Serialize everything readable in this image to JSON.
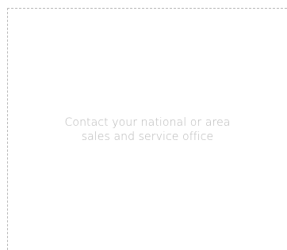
{
  "contact_card": {
    "message": "Contact your national or area sales and service office"
  }
}
